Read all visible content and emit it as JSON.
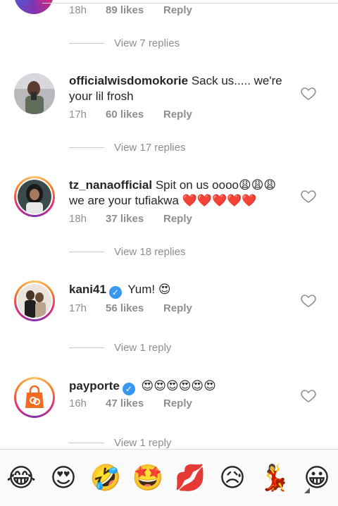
{
  "top_meta": {
    "time": "18h",
    "likes": "89 likes",
    "reply": "Reply"
  },
  "replies_1": "View 7 replies",
  "comments": [
    {
      "username": "officialwisdomokorie",
      "text": "Sack us..... we're your lil frosh",
      "time": "17h",
      "likes": "60 likes",
      "reply": "Reply",
      "view_replies": "View 17 replies",
      "verified": false
    },
    {
      "username": "tz_nanaofficial",
      "text": "Spit on us oooo😩😩😩 we are your tufiakwa ❤️❤️❤️❤️❤️",
      "time": "18h",
      "likes": "37 likes",
      "reply": "Reply",
      "view_replies": "View 18 replies",
      "verified": false
    },
    {
      "username": "kani41",
      "text": "Yum! 😍",
      "time": "17h",
      "likes": "56 likes",
      "reply": "Reply",
      "view_replies": "View 1 reply",
      "verified": true
    },
    {
      "username": "payporte",
      "text": "😍😍😍😍😍😍",
      "time": "16h",
      "likes": "47 likes",
      "reply": "Reply",
      "view_replies": "View 1 reply",
      "verified": true
    }
  ],
  "emoji_bar": [
    "😂",
    "😍",
    "🤣",
    "🤩",
    "💋",
    "😥",
    "💃",
    "😀"
  ]
}
